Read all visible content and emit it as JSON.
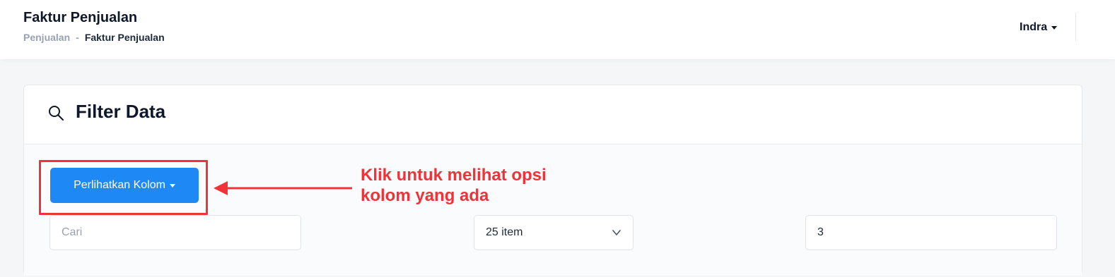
{
  "header": {
    "title": "Faktur Penjualan",
    "breadcrumb": {
      "parent": "Penjualan",
      "separator": "-",
      "current": "Faktur Penjualan"
    },
    "user_name": "Indra"
  },
  "filter_card": {
    "title": "Filter Data",
    "icon": "search-icon",
    "column_button_label": "Perlihatkan Kolom",
    "search_placeholder": "Cari",
    "page_size_value": "25 item",
    "page_value": "3"
  },
  "annotation": {
    "line1": "Klik untuk melihat opsi",
    "line2": "kolom yang ada",
    "color": "#ef3338"
  },
  "colors": {
    "primary_button": "#1e88f5",
    "annotation_red": "#ef3338"
  }
}
